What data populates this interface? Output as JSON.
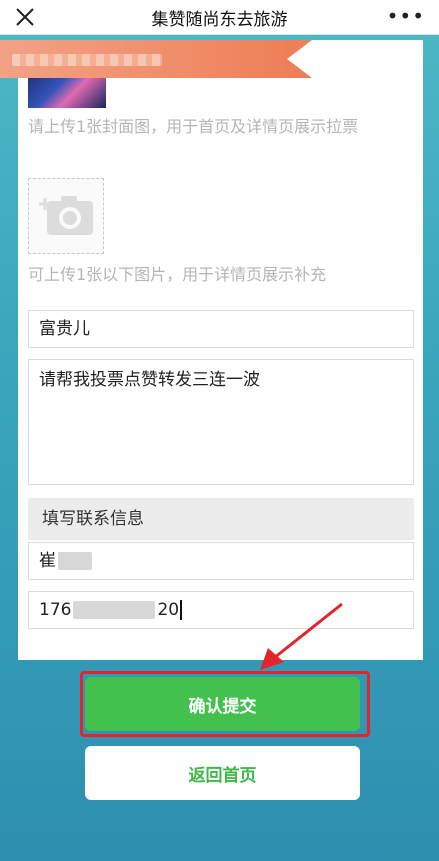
{
  "header": {
    "title": "集赞随尚东去旅游",
    "close_icon": "close-icon",
    "more_icon": "more-icon",
    "more_glyph": "•••"
  },
  "upload": {
    "cover_hint": "请上传1张封面图，用于首页及详情页展示拉票",
    "extra_hint": "可上传1张以下图片，用于详情页展示补充",
    "camera_icon": "camera-add-icon"
  },
  "form": {
    "name_value": "富贵儿",
    "message_value": "请帮我投票点赞转发三连一波",
    "contact_section_title": "填写联系信息",
    "contact_name_value": "崔",
    "phone_prefix": "176",
    "phone_suffix": "20"
  },
  "buttons": {
    "submit_label": "确认提交",
    "home_label": "返回首页"
  },
  "colors": {
    "submit_green": "#43c04d",
    "highlight_red": "#e3242b",
    "banner_orange": "#ee7d55"
  }
}
